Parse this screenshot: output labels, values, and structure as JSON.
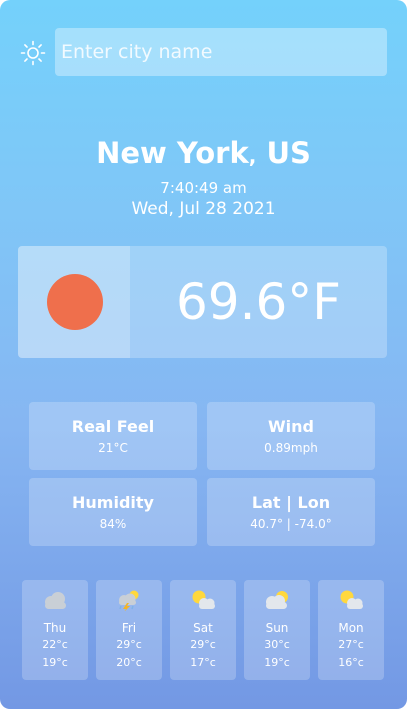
{
  "search": {
    "placeholder": "Enter city name",
    "value": ""
  },
  "location": {
    "city": "New York",
    "separator": ",",
    "country": "US"
  },
  "time": "7:40:49 am",
  "date": "Wed, Jul 28 2021",
  "current": {
    "temperature": "69.6°F",
    "icon": "sun-icon",
    "icon_color": "#ef6f4c"
  },
  "stats": [
    {
      "label": "Real Feel",
      "value": "21°C"
    },
    {
      "label": "Wind",
      "value": "0.89mph"
    },
    {
      "label": "Humidity",
      "value": "84%"
    },
    {
      "label": "Lat | Lon",
      "value": "40.7° | -74.0°"
    }
  ],
  "forecast": [
    {
      "day": "Thu",
      "high": "22°c",
      "low": "19°c",
      "icon": "cloud-icon"
    },
    {
      "day": "Fri",
      "high": "29°c",
      "low": "20°c",
      "icon": "thunderstorm-icon"
    },
    {
      "day": "Sat",
      "high": "29°c",
      "low": "17°c",
      "icon": "partly-cloudy-icon"
    },
    {
      "day": "Sun",
      "high": "30°c",
      "low": "19°c",
      "icon": "partly-cloudy-icon"
    },
    {
      "day": "Mon",
      "high": "27°c",
      "low": "16°c",
      "icon": "partly-cloudy-icon"
    }
  ]
}
